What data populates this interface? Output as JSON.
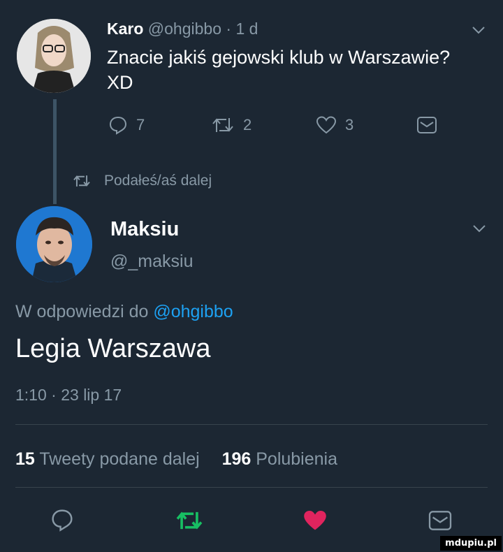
{
  "parent_tweet": {
    "name": "Karo",
    "handle": "@ohgibbo",
    "separator": "·",
    "time": "1 d",
    "text_line1": "Znacie jakiś gejowski klub w Warszawie?",
    "text_line2": "XD",
    "reply_count": "7",
    "retweet_count": "2",
    "like_count": "3"
  },
  "retweet_notice": "Podałeś/aś dalej",
  "reply_tweet": {
    "name": "Maksiu",
    "handle": "@_maksiu",
    "reply_to_prefix": "W odpowiedzi do",
    "reply_to_handle": "@ohgibbo",
    "text": "Legia Warszawa",
    "time": "1:10",
    "separator": "·",
    "date": "23 lip 17"
  },
  "stats": {
    "retweets_count": "15",
    "retweets_label": "Tweety podane dalej",
    "likes_count": "196",
    "likes_label": "Polubienia"
  },
  "watermark": "mdupiu.pl",
  "colors": {
    "background": "#1c2733",
    "text": "#ffffff",
    "muted": "#8899a6",
    "link": "#1da1f2",
    "retweet_active": "#17bf63",
    "like_active": "#e0245e"
  },
  "icons": [
    "chevron-down-icon",
    "reply-icon",
    "retweet-icon",
    "heart-icon",
    "message-icon"
  ]
}
